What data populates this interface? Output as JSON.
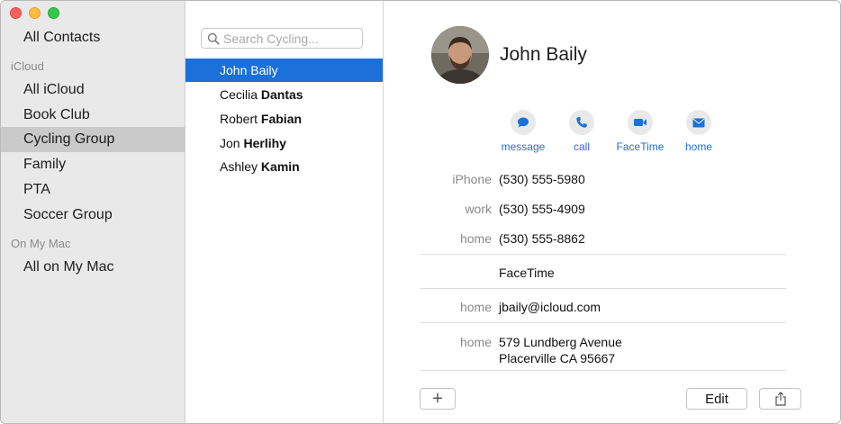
{
  "sidebar": {
    "all_contacts": "All Contacts",
    "icloud_header": "iCloud",
    "groups": [
      {
        "label": "All iCloud",
        "selected": false
      },
      {
        "label": "Book Club",
        "selected": false
      },
      {
        "label": "Cycling Group",
        "selected": true
      },
      {
        "label": "Family",
        "selected": false
      },
      {
        "label": "PTA",
        "selected": false
      },
      {
        "label": "Soccer Group",
        "selected": false
      }
    ],
    "on_my_mac_header": "On My Mac",
    "all_on_my_mac": "All on My Mac"
  },
  "search": {
    "placeholder": "Search Cycling...",
    "value": ""
  },
  "contacts": [
    {
      "first": "John",
      "last": "Baily",
      "selected": true
    },
    {
      "first": "Cecilia",
      "last": "Dantas",
      "selected": false
    },
    {
      "first": "Robert",
      "last": "Fabian",
      "selected": false
    },
    {
      "first": "Jon",
      "last": "Herlihy",
      "selected": false
    },
    {
      "first": "Ashley",
      "last": "Kamin",
      "selected": false
    }
  ],
  "detail": {
    "name": "John Baily",
    "actions": [
      {
        "label": "message",
        "icon": "message-icon"
      },
      {
        "label": "call",
        "icon": "phone-icon"
      },
      {
        "label": "FaceTime",
        "icon": "video-icon"
      },
      {
        "label": "home",
        "icon": "mail-icon"
      }
    ],
    "phones": [
      {
        "label": "iPhone",
        "value": "(530) 555-5980"
      },
      {
        "label": "work",
        "value": "(530) 555-4909"
      },
      {
        "label": "home",
        "value": "(530) 555-8862"
      }
    ],
    "facetime": "FaceTime",
    "email": {
      "label": "home",
      "value": "jbaily@icloud.com"
    },
    "address": {
      "label": "home",
      "line1": "579 Lundberg Avenue",
      "line2": "Placerville CA 95667"
    },
    "add_label": "+",
    "edit_label": "Edit",
    "share_icon": "share-icon"
  },
  "colors": {
    "accent": "#1b70d9",
    "sidebar_bg": "#e9e9e9",
    "sidebar_selected": "#cacaca"
  }
}
